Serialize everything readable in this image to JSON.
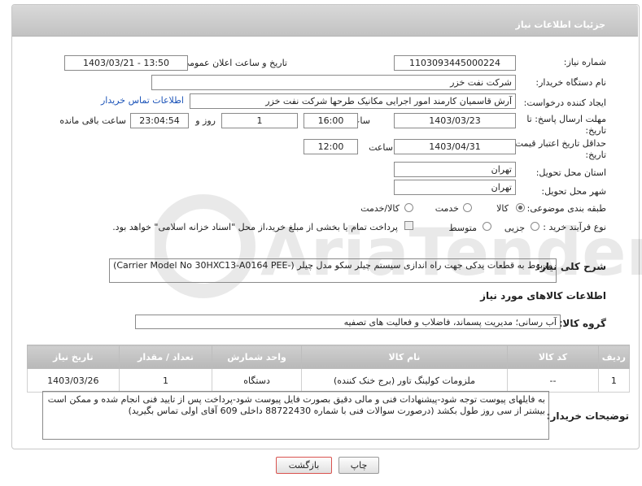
{
  "header": {
    "title": "جزئیات اطلاعات نیاز"
  },
  "form": {
    "need_number_label": "شماره نیاز:",
    "need_number": "1103093445000224",
    "announce_label": "تاریخ و ساعت اعلان عمومی:",
    "announce_value": "1403/03/21 - 13:50",
    "buyer_org_label": "نام دستگاه خریدار:",
    "buyer_org": "شرکت نفت خزر",
    "requester_label": "ایجاد کننده درخواست:",
    "requester": "آرش قاسمیان کارمند امور اجرایی مکانیک طرحها شرکت نفت خزر",
    "buyer_contact_link": "اطلاعات تماس خریدار",
    "deadline_label_1": "مهلت ارسال پاسخ: تا",
    "deadline_label_2": "تاریخ:",
    "deadline_date": "1403/03/23",
    "time_label": "ساعت",
    "deadline_time": "16:00",
    "days_value": "1",
    "days_label": "روز و",
    "remaining_time": "23:04:54",
    "remaining_label": "ساعت باقی مانده",
    "validity_label_1": "حداقل تاریخ اعتبار قیمت: تا",
    "validity_label_2": "تاریخ:",
    "validity_date": "1403/04/31",
    "validity_time": "12:00",
    "province_label": "استان محل تحویل:",
    "province": "تهران",
    "city_label": "شهر محل تحویل:",
    "city": "تهران",
    "category_label": "طبقه بندی موضوعی:",
    "category_options": [
      "کالا",
      "خدمت",
      "کالا/خدمت"
    ],
    "category_selected": "کالا",
    "process_label": "نوع فرآیند خرید :",
    "process_options": [
      "جزیی",
      "متوسط"
    ],
    "process_note": "پرداخت تمام یا بخشی از مبلغ خرید،از محل \"اسناد خزانه اسلامی\" خواهد بود."
  },
  "description": {
    "label": "شرح کلی نیاز:",
    "text": "مربوط به قطعات یدکی جهت راه اندازی سیستم چیلر سکو  مدل چیلر (-Carrier Model No 30HXC13-A0164 PEE)"
  },
  "goods_section": {
    "title": "اطلاعات کالاهای مورد نیاز",
    "group_label": "گروه کالا:",
    "group_value": "آب رسانی؛ مدیریت پسماند، فاضلاب و فعالیت های تصفیه"
  },
  "table": {
    "headers": [
      "ردیف",
      "کد کالا",
      "نام کالا",
      "واحد شمارش",
      "تعداد / مقدار",
      "تاریخ نیاز"
    ],
    "rows": [
      [
        "1",
        "--",
        "ملزومات کولینگ تاور (برج خنک کننده)",
        "دستگاه",
        "1",
        "1403/03/26"
      ]
    ]
  },
  "buyer_notes": {
    "label": "توضیحات خریدار:",
    "text": "به فایلهای پیوست توجه شود-پیشنهادات فنی و مالی دقیق بصورت فایل پیوست شود-پرداخت پس از تایید فنی انجام شده و ممکن است بیشتر از سی روز طول بکشد (درصورت سوالات فنی با شماره 88722430 داخلی 609 آقای اولی تماس بگیرید)"
  },
  "buttons": {
    "print": "چاپ",
    "back": "بازگشت"
  },
  "watermark": {
    "text": "AriaTender.neT"
  },
  "colors": {
    "link": "#1b53b8",
    "header_bg": "#c9c9c9",
    "back_button_border": "#d9534f"
  }
}
